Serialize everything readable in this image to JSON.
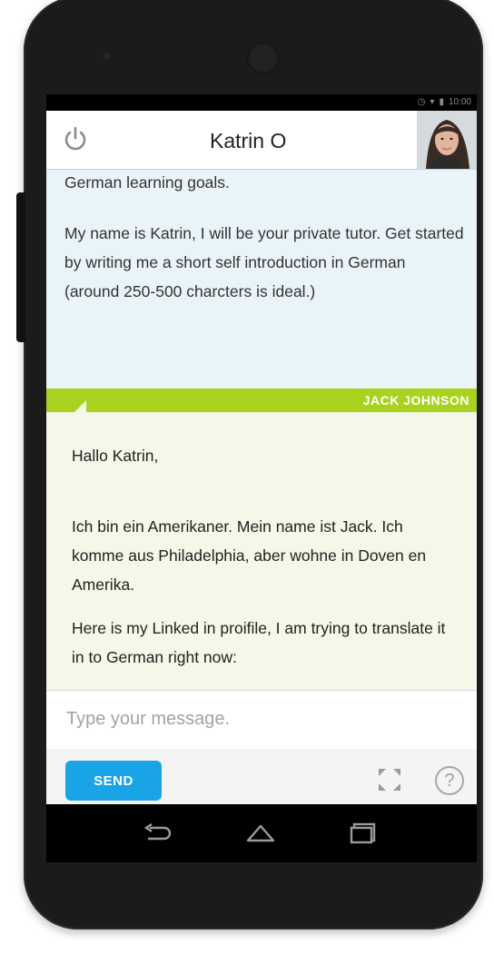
{
  "header": {
    "title": "Katrin O",
    "power_icon": "power-icon",
    "avatar_icon": "avatar"
  },
  "status_bar": {
    "time": "10:00"
  },
  "tutor_message": {
    "line1": "German learning goals.",
    "line2": "My name is Katrin, I will be your private tutor. Get started by writing me a short self introduction in German (around 250-500 charcters is ideal.)"
  },
  "student_banner": {
    "name": "JACK JOHNSON",
    "color": "#a8d21e"
  },
  "student_message": {
    "greeting": "Hallo Katrin,",
    "paragraph1": "Ich bin ein Amerikaner. Mein name ist Jack. Ich komme aus Philadelphia, aber wohne in Doven en Amerika.",
    "paragraph2": "Here is my Linked in proifile, I am trying to translate it in to German right now:"
  },
  "composer": {
    "placeholder": "Type your message.",
    "value": ""
  },
  "toolbar": {
    "send_label": "SEND",
    "send_color": "#1aa4e8",
    "help_glyph": "?"
  }
}
